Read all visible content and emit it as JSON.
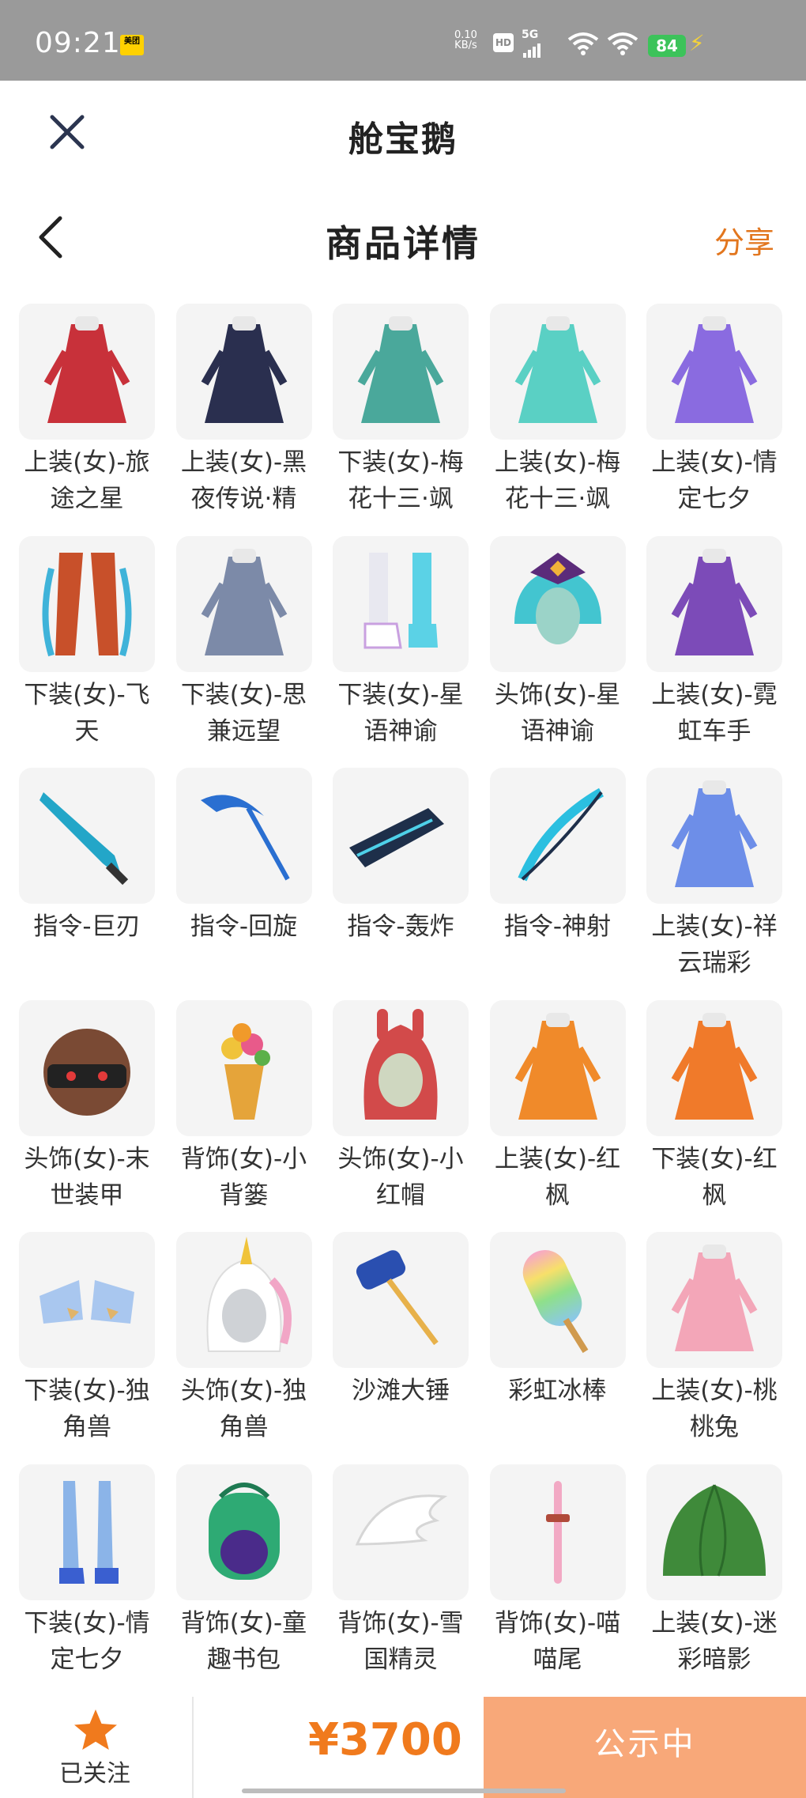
{
  "status_bar": {
    "time": "09:21",
    "app_badge": "美团",
    "net_speed_value": "0.10",
    "net_speed_unit": "KB/s",
    "hd": "HD",
    "network": "5G",
    "battery": "84"
  },
  "header": {
    "app_title": "舱宝鹅",
    "page_title": "商品详情",
    "share_label": "分享"
  },
  "items": [
    {
      "label": "上装(女)-旅途之星",
      "icon": "red-dress",
      "color": "#c8313a"
    },
    {
      "label": "上装(女)-黑夜传说·精",
      "icon": "dark-coat",
      "color": "#2a2f4f"
    },
    {
      "label": "下装(女)-梅花十三·飒",
      "icon": "teal-skirt",
      "color": "#4aa89b"
    },
    {
      "label": "上装(女)-梅花十三·飒",
      "icon": "teal-top",
      "color": "#5ad0c4"
    },
    {
      "label": "上装(女)-情定七夕",
      "icon": "purple-dress",
      "color": "#8a6be0"
    },
    {
      "label": "下装(女)-飞天",
      "icon": "blue-pants",
      "color": "#3fb3d9"
    },
    {
      "label": "下装(女)-思兼远望",
      "icon": "grey-skirt",
      "color": "#7c8aa8"
    },
    {
      "label": "下装(女)-星语神谕",
      "icon": "boots",
      "color": "#5bd2e6"
    },
    {
      "label": "头饰(女)-星语神谕",
      "icon": "crowned-head",
      "color": "#43c5d0"
    },
    {
      "label": "上装(女)-霓虹车手",
      "icon": "purple-jacket",
      "color": "#7c4bb8"
    },
    {
      "label": "指令-巨刃",
      "icon": "blade",
      "color": "#23a6c8"
    },
    {
      "label": "指令-回旋",
      "icon": "scythe",
      "color": "#2a6fd1"
    },
    {
      "label": "指令-轰炸",
      "icon": "launcher",
      "color": "#1e2f4a"
    },
    {
      "label": "指令-神射",
      "icon": "bow",
      "color": "#2bbfe0"
    },
    {
      "label": "上装(女)-祥云瑞彩",
      "icon": "blue-robe",
      "color": "#6d8ee8"
    },
    {
      "label": "头饰(女)-末世装甲",
      "icon": "armor-helmet",
      "color": "#7a4a34"
    },
    {
      "label": "背饰(女)-小背篓",
      "icon": "flower-basket",
      "color": "#e5a43a"
    },
    {
      "label": "头饰(女)-小红帽",
      "icon": "red-hood",
      "color": "#d24a4a"
    },
    {
      "label": "上装(女)-红枫",
      "icon": "maple-top",
      "color": "#f08a2a"
    },
    {
      "label": "下装(女)-红枫",
      "icon": "maple-skirt",
      "color": "#f07a2a"
    },
    {
      "label": "下装(女)-独角兽",
      "icon": "unicorn-shoes",
      "color": "#a9c7ef"
    },
    {
      "label": "头饰(女)-独角兽",
      "icon": "unicorn-hood",
      "color": "#f1a6c6"
    },
    {
      "label": "沙滩大锤",
      "icon": "hammer",
      "color": "#2a4fb0"
    },
    {
      "label": "彩虹冰棒",
      "icon": "rainbow-popsicle",
      "color": "#f7a6c8"
    },
    {
      "label": "上装(女)-桃桃兔",
      "icon": "pink-dress",
      "color": "#f3a6b8"
    },
    {
      "label": "下装(女)-情定七夕",
      "icon": "blue-legs",
      "color": "#8bb4e8"
    },
    {
      "label": "背饰(女)-童趣书包",
      "icon": "green-backpack",
      "color": "#2eaa74"
    },
    {
      "label": "背饰(女)-雪国精灵",
      "icon": "white-wings",
      "color": "#dcdcdc"
    },
    {
      "label": "背饰(女)-喵喵尾",
      "icon": "pink-tail",
      "color": "#f2a9c4"
    },
    {
      "label": "上装(女)-迷彩暗影",
      "icon": "leaf-cape",
      "color": "#3f8a3a"
    }
  ],
  "bottom": {
    "follow_label": "已关注",
    "price": "¥3700",
    "status_label": "公示中",
    "accent": "#f07a1d"
  }
}
